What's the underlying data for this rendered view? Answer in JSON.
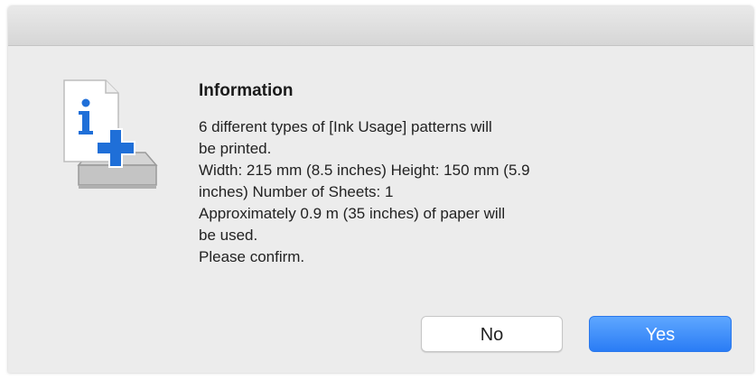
{
  "dialog": {
    "heading": "Information",
    "message_lines": [
      "6 different types of [Ink Usage] patterns will",
      "be printed.",
      "Width: 215 mm (8.5 inches) Height: 150 mm (5.9",
      "inches) Number of Sheets: 1",
      "Approximately 0.9 m (35 inches) of paper will",
      "be used.",
      "Please confirm."
    ],
    "icon": "info-document-printer-icon"
  },
  "buttons": {
    "no_label": "No",
    "yes_label": "Yes"
  },
  "colors": {
    "accent": "#2a7cf5",
    "icon_blue": "#1f6fd8",
    "dialog_bg": "#ececec"
  }
}
